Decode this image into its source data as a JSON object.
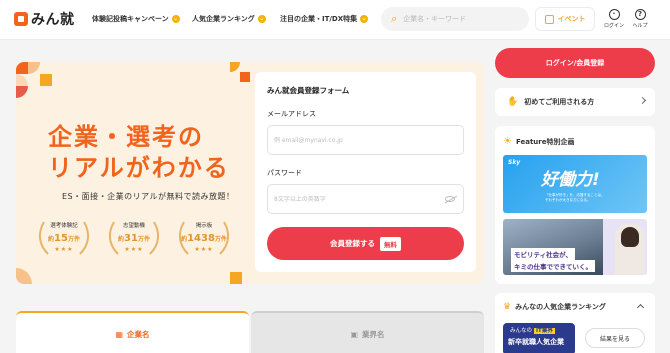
{
  "header": {
    "logo_text": "みん就",
    "nav": [
      {
        "label": "体験記投稿キャンペーン"
      },
      {
        "label": "人気企業ランキング"
      },
      {
        "label": "注目の企業・IT/DX特集"
      }
    ],
    "search_placeholder": "企業名・キーワード",
    "event_label": "イベント",
    "login_icon_label": "ログイン",
    "help_icon_label": "ヘルプ"
  },
  "hero": {
    "title_line1": "企業・選考の",
    "title_line2": "リアルがわかる",
    "subtitle": "ES・面接・企業のリアルが無料で読み放題！",
    "stats": [
      {
        "label": "選考体験記",
        "prefix": "約",
        "value": "15",
        "unit": "万件",
        "stars": "★★★"
      },
      {
        "label": "志望動機",
        "prefix": "約",
        "value": "31",
        "unit": "万件",
        "stars": "★★★"
      },
      {
        "label": "掲示板",
        "prefix": "約",
        "value": "1438",
        "unit": "万件",
        "stars": "★★★"
      }
    ]
  },
  "form": {
    "title": "みん就会員登録フォーム",
    "email_label": "メールアドレス",
    "email_placeholder": "例 email@mynavi.co.jp",
    "password_label": "パスワード",
    "password_placeholder": "8文字以上の英数字",
    "submit_label": "会員登録する",
    "free_badge": "無料"
  },
  "tabs": [
    {
      "label": "企業名"
    },
    {
      "label": "業界名"
    }
  ],
  "sidebar": {
    "login_button": "ログイン/会員登録",
    "first_time": "初めてご利用される方",
    "feature_title": "Feature特別企画",
    "banner1": {
      "brand": "Sky",
      "headline": "好働力!",
      "caption_line1": "「仕事が好き」を、応援することは、",
      "caption_line2": "それぞれが大きな力になる。"
    },
    "banner2": {
      "line1": "モビリティ社会が、",
      "line2": "キミの仕事でできていく。"
    },
    "ranking_title": "みんなの人気企業ランキング",
    "rank_banner": {
      "line1_prefix": "みんなの",
      "line1_tag": "IT業界",
      "line2": "新卒就職人気企業"
    },
    "result_button": "結果を見る"
  },
  "colors": {
    "accent": "#f0641e",
    "primary_red": "#ed3d4a",
    "yellow": "#f5a623",
    "hero_bg": "#fdf1e2"
  }
}
